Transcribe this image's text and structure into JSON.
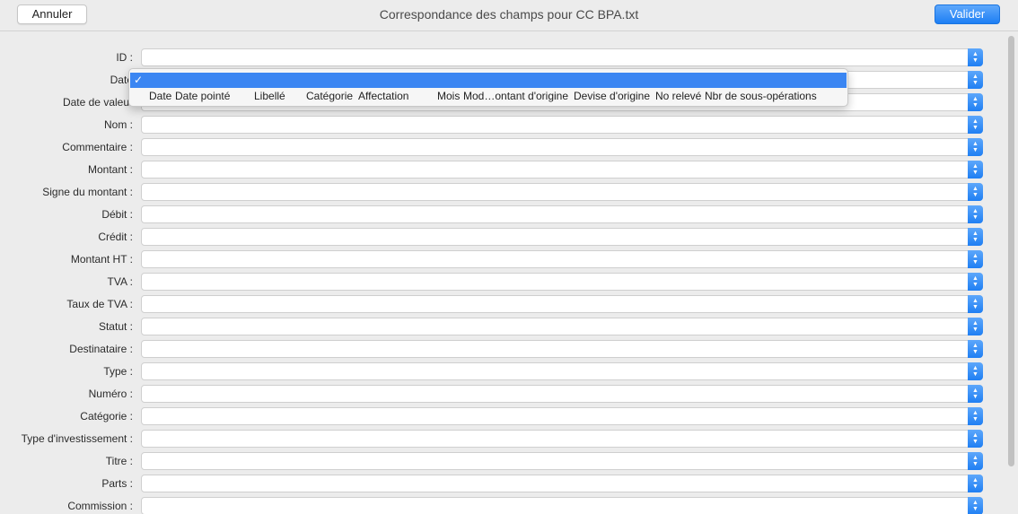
{
  "titlebar": {
    "cancel_label": "Annuler",
    "title": "Correspondance des champs pour CC BPA.txt",
    "validate_label": "Valider"
  },
  "colors": {
    "accent": "#1d7ff4",
    "selection": "#3b86f2",
    "background": "#ececec"
  },
  "fields": [
    {
      "label": "ID :",
      "value": ""
    },
    {
      "label": "Date",
      "value": ""
    },
    {
      "label": "Date de valeur",
      "value": ""
    },
    {
      "label": "Nom :",
      "value": ""
    },
    {
      "label": "Commentaire :",
      "value": ""
    },
    {
      "label": "Montant :",
      "value": ""
    },
    {
      "label": "Signe du montant :",
      "value": ""
    },
    {
      "label": "Débit :",
      "value": ""
    },
    {
      "label": "Crédit :",
      "value": ""
    },
    {
      "label": "Montant HT :",
      "value": ""
    },
    {
      "label": "TVA :",
      "value": ""
    },
    {
      "label": "Taux de TVA :",
      "value": ""
    },
    {
      "label": "Statut :",
      "value": ""
    },
    {
      "label": "Destinataire :",
      "value": ""
    },
    {
      "label": "Type :",
      "value": ""
    },
    {
      "label": "Numéro :",
      "value": ""
    },
    {
      "label": "Catégorie :",
      "value": ""
    },
    {
      "label": "Type d'investissement :",
      "value": ""
    },
    {
      "label": "Titre :",
      "value": ""
    },
    {
      "label": "Parts :",
      "value": ""
    },
    {
      "label": "Commission :",
      "value": ""
    }
  ],
  "dropdown": {
    "selected_check": "✓",
    "option_parts": [
      "Date",
      "Date pointé",
      "Libellé",
      "Catégorie",
      "Affectation",
      "Mois",
      "Mod…ontant d'origine",
      "Devise d'origine",
      "No relevé",
      "Nbr de sous-opérations"
    ]
  }
}
